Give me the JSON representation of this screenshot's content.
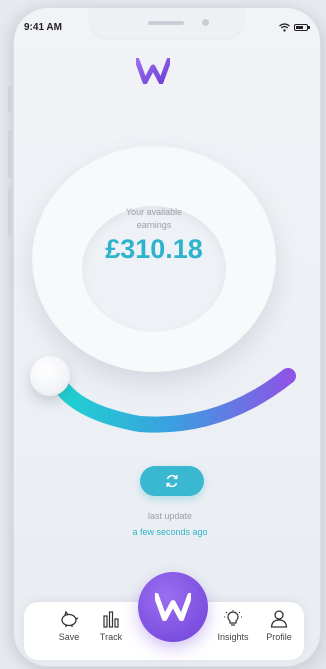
{
  "status": {
    "time": "9:41 AM"
  },
  "brand": {
    "logo_icon": "w-logo-icon",
    "accent": "#7c4fe0",
    "secondary": "#2eb3cc"
  },
  "earnings": {
    "label_line1": "Your available",
    "label_line2": "earnings",
    "amount": "£310.18"
  },
  "refresh": {
    "icon": "refresh-icon"
  },
  "update": {
    "label": "last update",
    "value": "a few seconds ago"
  },
  "tabs": [
    {
      "label": "Save",
      "icon": "piggy-bank-icon"
    },
    {
      "label": "Track",
      "icon": "bar-chart-icon"
    },
    {
      "label": "Insights",
      "icon": "lightbulb-icon"
    },
    {
      "label": "Profile",
      "icon": "user-icon"
    }
  ]
}
